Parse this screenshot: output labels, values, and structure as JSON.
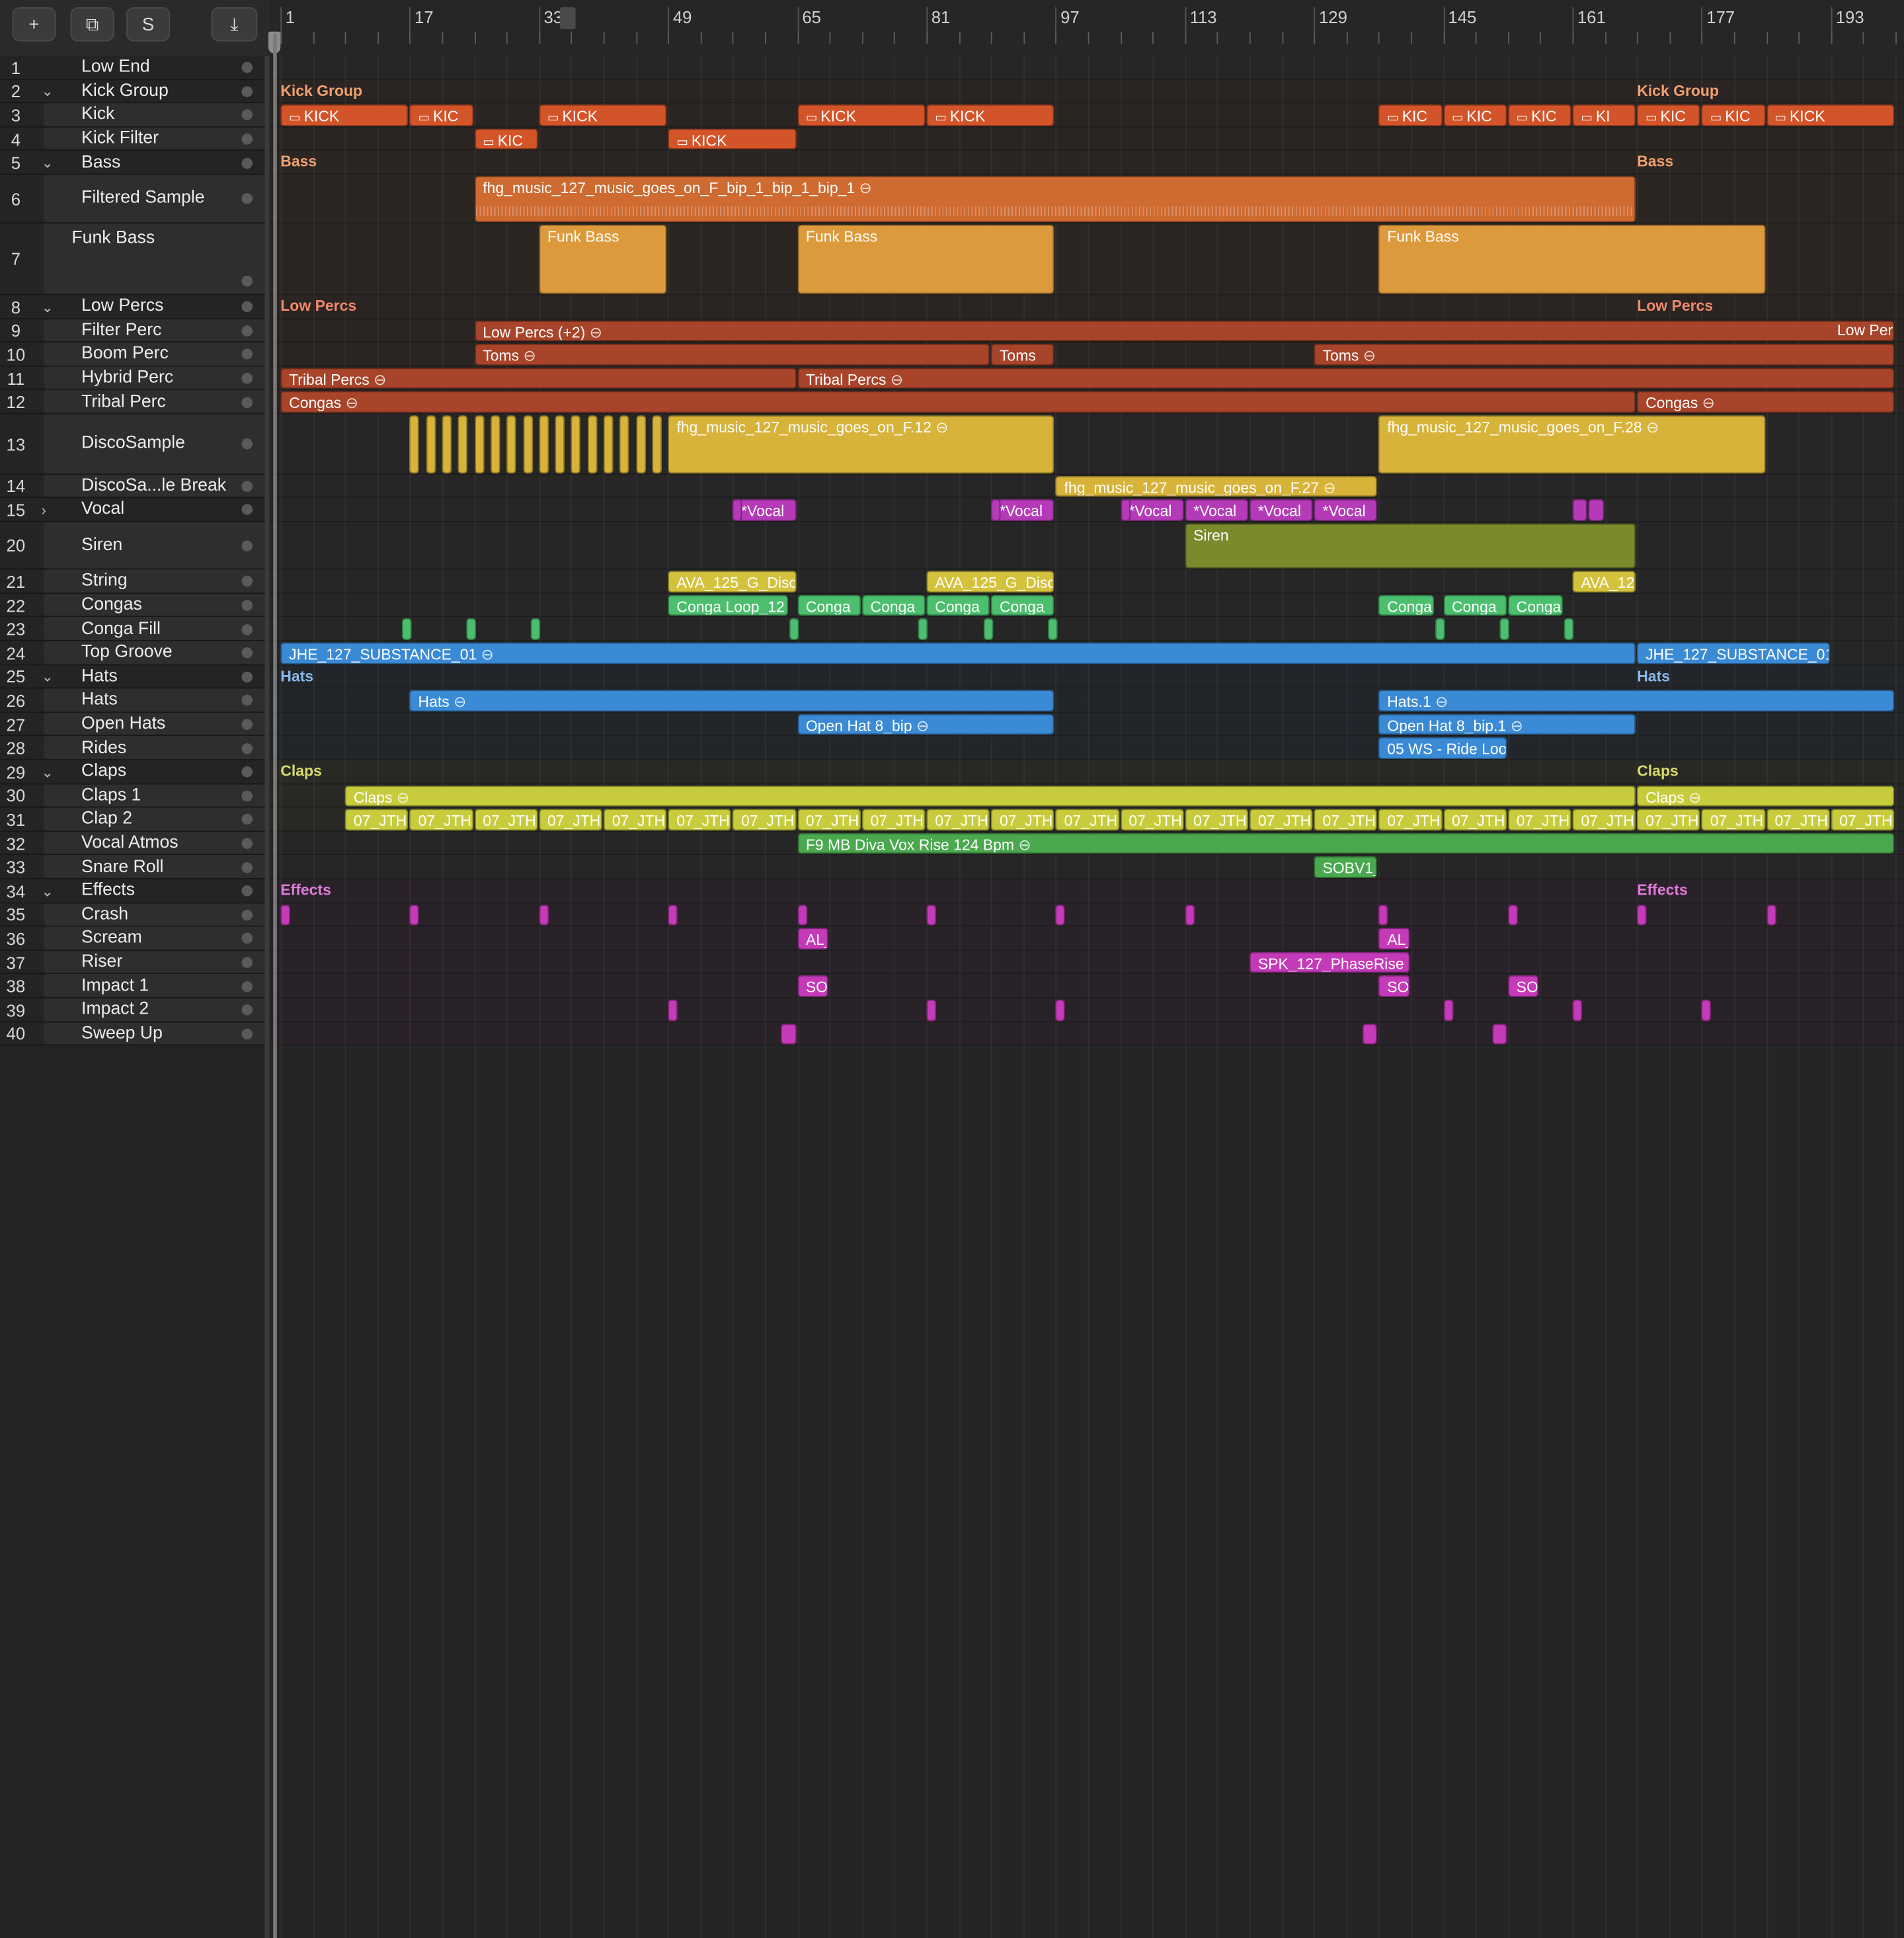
{
  "toolbar": {
    "add_label": "+",
    "duplicate_label": "⧉",
    "solo_label": "S",
    "download_label": "⤓"
  },
  "ruler": {
    "bars": [
      "1",
      "17",
      "33",
      "49",
      "65",
      "81",
      "97",
      "113",
      "129",
      "145",
      "161",
      "177",
      "193"
    ]
  },
  "tracks": [
    {
      "num": "1",
      "name": "Low End"
    },
    {
      "num": "2",
      "name": "Kick Group",
      "disclosure": "open"
    },
    {
      "num": "3",
      "name": "Kick"
    },
    {
      "num": "4",
      "name": "Kick Filter"
    },
    {
      "num": "5",
      "name": "Bass",
      "disclosure": "open"
    },
    {
      "num": "6",
      "name": "Filtered Sample"
    },
    {
      "num": "7",
      "name": "Funk Bass"
    },
    {
      "num": "8",
      "name": "Low Percs",
      "disclosure": "open"
    },
    {
      "num": "9",
      "name": "Filter Perc"
    },
    {
      "num": "10",
      "name": "Boom Perc"
    },
    {
      "num": "11",
      "name": "Hybrid Perc"
    },
    {
      "num": "12",
      "name": "Tribal Perc"
    },
    {
      "num": "13",
      "name": "DiscoSample"
    },
    {
      "num": "14",
      "name": "DiscoSa...le Break"
    },
    {
      "num": "15",
      "name": "Vocal",
      "disclosure": "closed"
    },
    {
      "num": "20",
      "name": "Siren"
    },
    {
      "num": "21",
      "name": "String"
    },
    {
      "num": "22",
      "name": "Congas"
    },
    {
      "num": "23",
      "name": "Conga Fill"
    },
    {
      "num": "24",
      "name": "Top Groove"
    },
    {
      "num": "25",
      "name": "Hats",
      "disclosure": "open"
    },
    {
      "num": "26",
      "name": "Hats"
    },
    {
      "num": "27",
      "name": "Open Hats"
    },
    {
      "num": "28",
      "name": "Rides"
    },
    {
      "num": "29",
      "name": "Claps",
      "disclosure": "open"
    },
    {
      "num": "30",
      "name": "Claps 1"
    },
    {
      "num": "31",
      "name": "Clap 2"
    },
    {
      "num": "32",
      "name": "Vocal Atmos"
    },
    {
      "num": "33",
      "name": "Snare Roll"
    },
    {
      "num": "34",
      "name": "Effects",
      "disclosure": "open"
    },
    {
      "num": "35",
      "name": "Crash"
    },
    {
      "num": "36",
      "name": "Scream"
    },
    {
      "num": "37",
      "name": "Riser"
    },
    {
      "num": "38",
      "name": "Impact 1"
    },
    {
      "num": "39",
      "name": "Impact 2"
    },
    {
      "num": "40",
      "name": "Sweep Up"
    }
  ],
  "group_labels": {
    "kick_group": "Kick Group",
    "bass": "Bass",
    "low_percs": "Low Percs",
    "low_percs_end": "Low Per",
    "hats": "Hats",
    "claps": "Claps",
    "effects": "Effects"
  },
  "regions": {
    "kick": "KICK",
    "kick_short": "KIC",
    "kick_shorter": "KI",
    "filtered_sample": "fhg_music_127_music_goes_on_F_bip_1_bip_1_bip_1",
    "funk_bass": "Funk Bass",
    "low_percs_folder": "Low Percs (+2)",
    "toms": "Toms",
    "tribal_percs": "Tribal Percs",
    "congas_perc": "Congas",
    "disco_f12": "fhg_music_127_music_goes_on_F.12",
    "disco_f28": "fhg_music_127_music_goes_on_F.28",
    "disco_f27": "fhg_music_127_music_goes_on_F.27",
    "vocal": "*Vocal",
    "siren": "Siren",
    "string": "AVA_125_G_Disc",
    "string_short": "AVA_12",
    "conga_loop": "Conga Loop_12",
    "conga": "Conga",
    "top_groove": "JHE_127_SUBSTANCE_01",
    "hats": "Hats",
    "hats1": "Hats.1",
    "open_hat": "Open Hat 8_bip",
    "open_hat1": "Open Hat 8_bip.1",
    "ride": "05 WS - Ride Loo",
    "claps": "Claps",
    "clap2": "07_JTH",
    "vox_rise": "F9 MB Diva Vox Rise 124 Bpm",
    "snare_roll": "SOBV1_",
    "scream": "AL_",
    "riser": "SPK_127_PhaseRise",
    "impact": "SO"
  },
  "colors": {
    "kick": "#d4542a",
    "bass_sample": "#cf6a30",
    "funk_bass": "#dd9a3c",
    "low_percs": "#a8442a",
    "disco": "#d8b33a",
    "vocal": "#b53ab8",
    "siren": "#7a8a2c",
    "string": "#d4c23c",
    "conga": "#4cbf6e",
    "blue": "#3a8ad6",
    "claps": "#c8cc3c",
    "vox_rise": "#4aa84e",
    "effects": "#c43ab8"
  }
}
